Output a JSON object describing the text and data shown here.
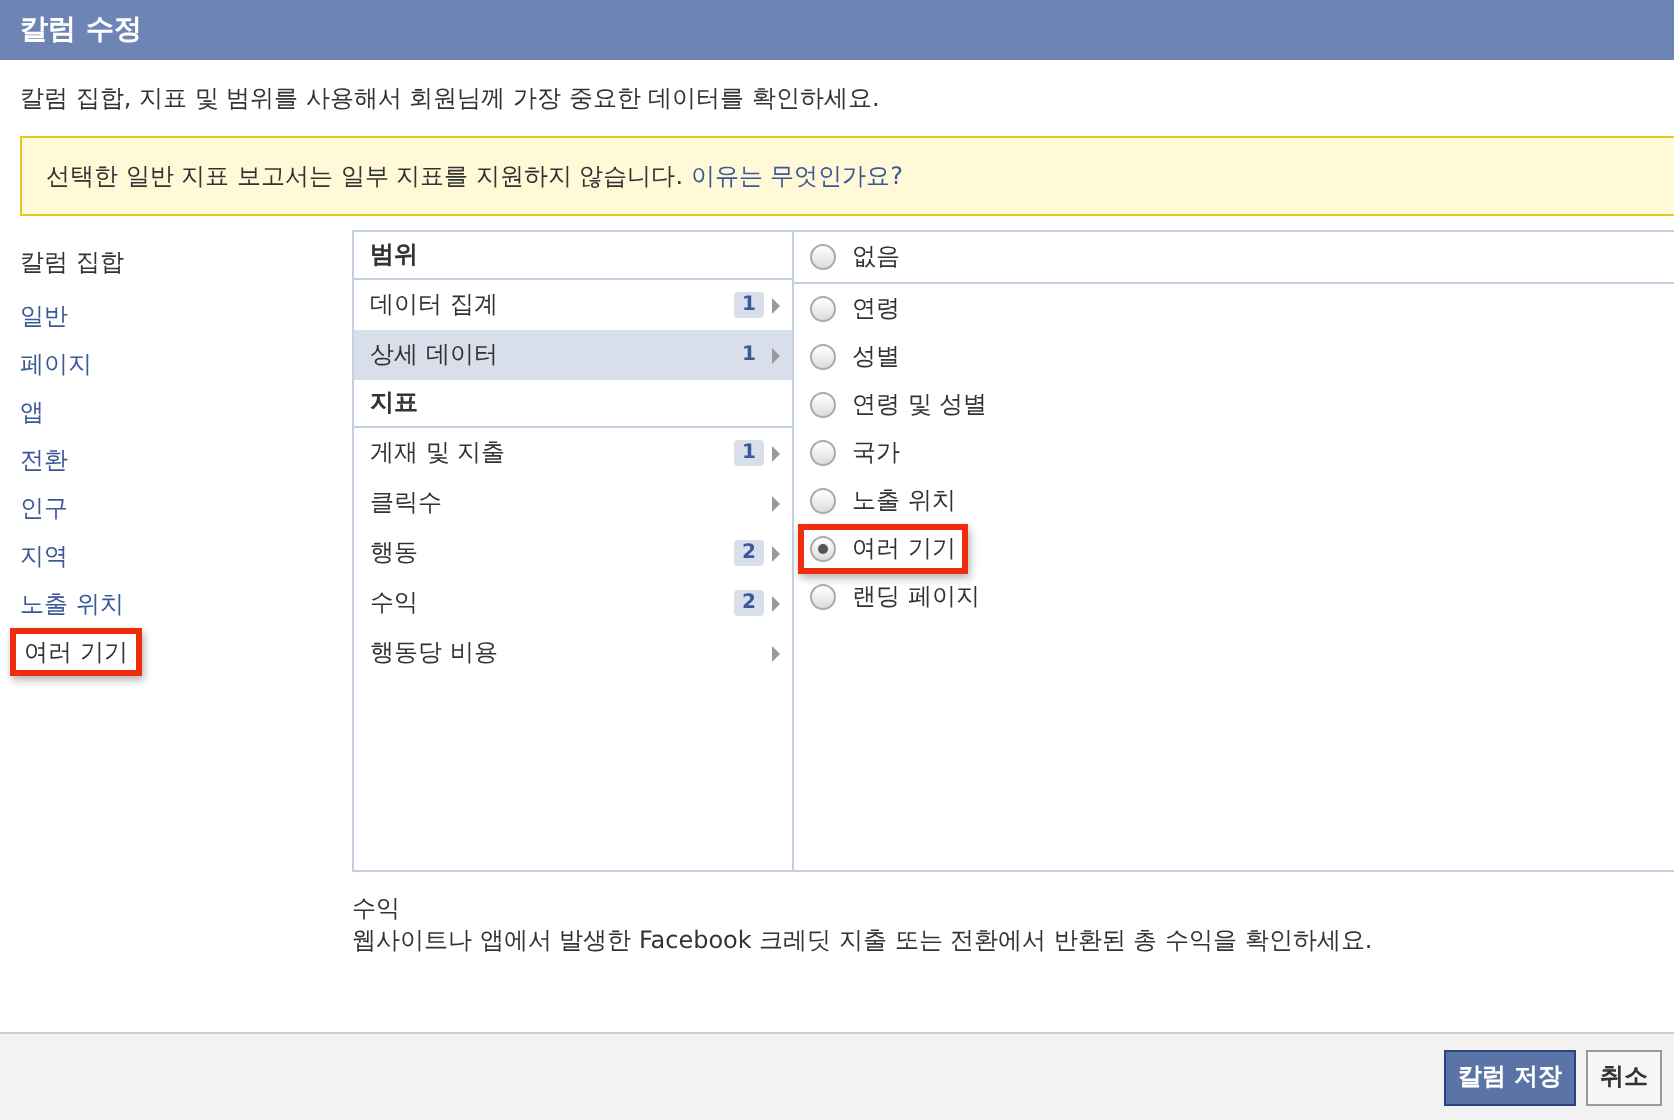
{
  "dialog": {
    "title": "칼럼 수정",
    "subtitle": "칼럼 집합, 지표 및 범위를 사용해서 회원님께 가장 중요한 데이터를 확인하세요."
  },
  "notice": {
    "text": "선택한 일반 지표 보고서는 일부 지표를 지원하지 않습니다.",
    "link": "이유는 무엇인가요?"
  },
  "column_sets": {
    "heading": "칼럼 집합",
    "items": [
      {
        "label": "일반",
        "selected": false,
        "highlighted": false
      },
      {
        "label": "페이지",
        "selected": false,
        "highlighted": false
      },
      {
        "label": "앱",
        "selected": false,
        "highlighted": false
      },
      {
        "label": "전환",
        "selected": false,
        "highlighted": false
      },
      {
        "label": "인구",
        "selected": false,
        "highlighted": false
      },
      {
        "label": "지역",
        "selected": false,
        "highlighted": false
      },
      {
        "label": "노출 위치",
        "selected": false,
        "highlighted": false
      },
      {
        "label": "여러 기기",
        "selected": true,
        "highlighted": true
      }
    ]
  },
  "categories": [
    {
      "heading": "범위",
      "items": [
        {
          "label": "데이터 집계",
          "count": "1",
          "selected": false
        },
        {
          "label": "상세 데이터",
          "count": "1",
          "selected": true
        }
      ]
    },
    {
      "heading": "지표",
      "items": [
        {
          "label": "게재 및 지출",
          "count": "1",
          "selected": false
        },
        {
          "label": "클릭수",
          "selected": false
        },
        {
          "label": "행동",
          "count": "2",
          "selected": false
        },
        {
          "label": "수익",
          "count": "2",
          "selected": false
        },
        {
          "label": "행동당 비용",
          "selected": false
        }
      ]
    }
  ],
  "options": [
    {
      "label": "없음",
      "selected": false,
      "highlighted": false
    },
    {
      "label": "연령",
      "selected": false,
      "highlighted": false
    },
    {
      "label": "성별",
      "selected": false,
      "highlighted": false
    },
    {
      "label": "연령 및 성별",
      "selected": false,
      "highlighted": false
    },
    {
      "label": "국가",
      "selected": false,
      "highlighted": false
    },
    {
      "label": "노출 위치",
      "selected": false,
      "highlighted": false
    },
    {
      "label": "여러 기기",
      "selected": true,
      "highlighted": true
    },
    {
      "label": "랜딩 페이지",
      "selected": false,
      "highlighted": false
    }
  ],
  "description": {
    "title": "수익",
    "text": "웹사이트나 앱에서 발생한 Facebook 크레딧 지출 또는 전환에서 반환된 총 수익을 확인하세요."
  },
  "buttons": [
    {
      "label": "칼럼 저장",
      "kind": "primary"
    },
    {
      "label": "취소",
      "kind": "secondary"
    }
  ]
}
